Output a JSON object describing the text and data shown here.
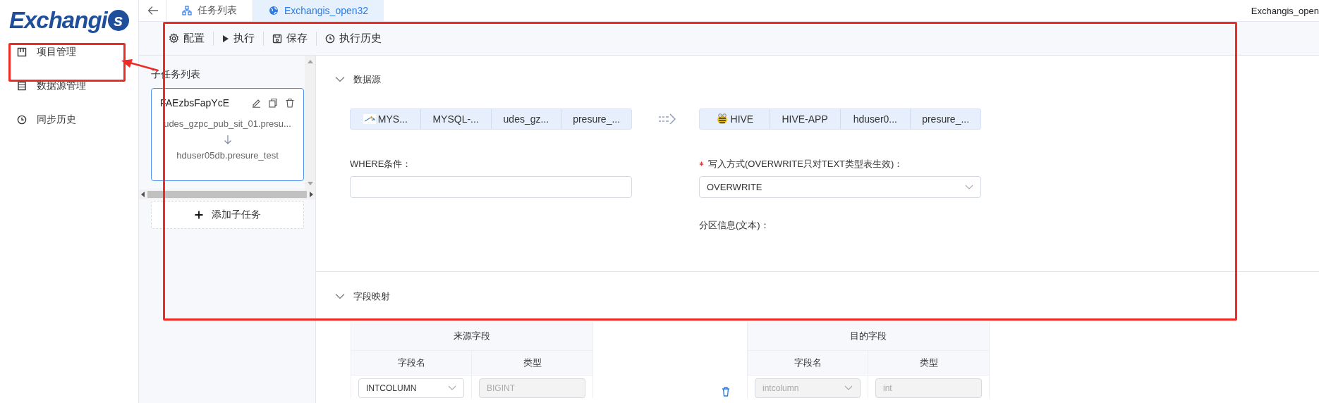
{
  "logo": {
    "text": "Exchangi",
    "badge": "s"
  },
  "sidebar": {
    "items": [
      {
        "label": "项目管理"
      },
      {
        "label": "数据源管理"
      },
      {
        "label": "同步历史"
      }
    ]
  },
  "tabs": [
    {
      "label": "任务列表",
      "selected": false
    },
    {
      "label": "Exchangis_open32",
      "selected": true
    }
  ],
  "header_right": "Exchangis_open",
  "toolbar": [
    "配置",
    "执行",
    "保存",
    "执行历史"
  ],
  "subtasks": {
    "title": "子任务列表",
    "items": [
      {
        "name": "FAEzbsFapYcE",
        "source": "udes_gzpc_pub_sit_01.presu...",
        "target": "hduser05db.presure_test",
        "selected": true
      }
    ],
    "add_label": "添加子任务"
  },
  "data_source": {
    "title": "数据源",
    "expanded": true,
    "source": [
      "MYS...",
      "MYSQL-...",
      "udes_gz...",
      "presure_..."
    ],
    "target": [
      "HIVE",
      "HIVE-APP",
      "hduser0...",
      "presure_..."
    ],
    "where": {
      "label": "WHERE条件："
    },
    "write_mode": {
      "label": "写入方式(OVERWRITE只对TEXT类型表生效)：",
      "required": true,
      "value": "OVERWRITE"
    },
    "partition": {
      "label": "分区信息(文本)："
    }
  },
  "field_mapping": {
    "title": "字段映射",
    "expanded": true,
    "source_table": {
      "title": "来源字段",
      "columns": [
        "字段名",
        "类型"
      ],
      "rows": [
        {
          "name": "INTCOLUMN",
          "type": "BIGINT",
          "disabled": false
        }
      ]
    },
    "target_table": {
      "title": "目的字段",
      "columns": [
        "字段名",
        "类型"
      ],
      "rows": [
        {
          "name": "intcolumn",
          "type": "int",
          "disabled": true
        }
      ]
    }
  },
  "annotations": [
    {
      "kind": "box"
    },
    {
      "kind": "box"
    },
    {
      "kind": "arrow"
    }
  ]
}
